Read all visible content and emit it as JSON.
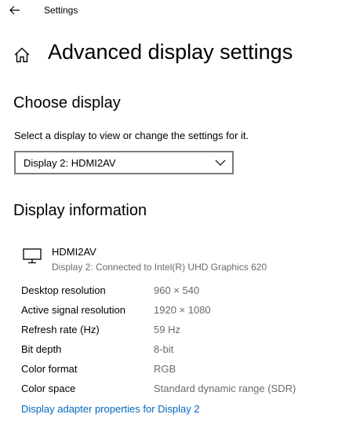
{
  "titlebar": {
    "back_icon": "back-arrow-icon",
    "app_title": "Settings"
  },
  "header": {
    "home_icon": "home-icon",
    "title": "Advanced display settings"
  },
  "choose_display": {
    "heading": "Choose display",
    "description": "Select a display to view or change the settings for it.",
    "dropdown": {
      "selected": "Display 2: HDMI2AV",
      "chevron_icon": "chevron-down-icon"
    }
  },
  "display_information": {
    "heading": "Display information",
    "monitor_icon": "monitor-icon",
    "display_name": "HDMI2AV",
    "display_subtitle": "Display 2: Connected to Intel(R) UHD Graphics 620",
    "rows": [
      {
        "label": "Desktop resolution",
        "value": "960 × 540"
      },
      {
        "label": "Active signal resolution",
        "value": "1920 × 1080"
      },
      {
        "label": "Refresh rate (Hz)",
        "value": "59 Hz"
      },
      {
        "label": "Bit depth",
        "value": "8-bit"
      },
      {
        "label": "Color format",
        "value": "RGB"
      },
      {
        "label": "Color space",
        "value": "Standard dynamic range (SDR)"
      }
    ],
    "adapter_link": "Display adapter properties for Display 2"
  },
  "colors": {
    "link": "#0067c0",
    "secondary_text": "#6b6b6b",
    "dropdown_border": "#7a7a7a"
  }
}
